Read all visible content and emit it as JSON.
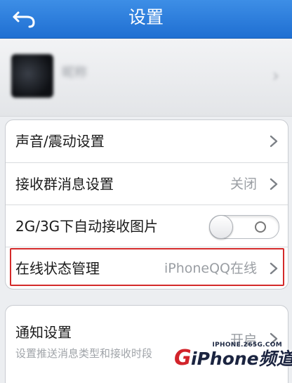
{
  "header": {
    "title": "设置",
    "back_icon": "back-arrow-icon"
  },
  "profile": {
    "name": "昵称",
    "avatar_icon": "avatar-image",
    "chevron_icon": "chevron-right-icon"
  },
  "settings_group": {
    "rows": [
      {
        "label": "声音/震动设置",
        "value": "",
        "control": "chevron"
      },
      {
        "label": "接收群消息设置",
        "value": "关闭",
        "control": "chevron"
      },
      {
        "label": "2G/3G下自动接收图片",
        "value": "",
        "control": "toggle",
        "toggle_on": false
      },
      {
        "label": "在线状态管理",
        "value": "iPhoneQQ在线",
        "control": "chevron",
        "highlighted": true
      }
    ]
  },
  "notification_group": {
    "label": "通知设置",
    "sublabel": "设置推送消息类型和接收时段",
    "value": "开启"
  },
  "watermark": {
    "url": "IPHONE.265G.COM",
    "logo_text": "iPhone频道",
    "logo_letter": "G",
    "colors": {
      "red": "#d2232a",
      "navy": "#1b2440"
    }
  },
  "colors": {
    "navbar": "#2a7ddc",
    "highlight": "#d42a2a",
    "background": "#eceef1"
  }
}
